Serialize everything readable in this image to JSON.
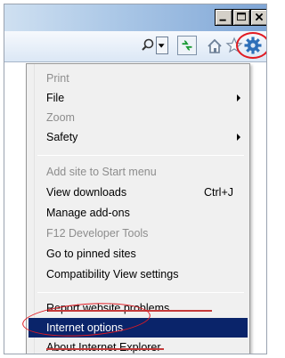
{
  "menu": {
    "items": [
      {
        "label": "Print",
        "state": "disabled"
      },
      {
        "label": "File",
        "submenu": true
      },
      {
        "label": "Zoom",
        "state": "disabled"
      },
      {
        "label": "Safety",
        "submenu": true
      },
      {
        "label": "Add site to Start menu",
        "state": "disabled"
      },
      {
        "label": "View downloads",
        "shortcut": "Ctrl+J"
      },
      {
        "label": "Manage add-ons"
      },
      {
        "label": "F12 Developer Tools",
        "state": "disabled"
      },
      {
        "label": "Go to pinned sites"
      },
      {
        "label": "Compatibility View settings"
      },
      {
        "label": "Report website problems"
      },
      {
        "label": "Internet options",
        "state": "selected"
      },
      {
        "label": "About Internet Explorer"
      }
    ]
  },
  "toolbar": {
    "icons": [
      "search-icon",
      "dropdown-arrow-icon",
      "refresh-icon",
      "home-icon",
      "star-icon",
      "gear-icon"
    ]
  },
  "colors": {
    "highlight": "#0a246a",
    "annotation": "#e11a22",
    "disabled_text": "#8d8d8d"
  }
}
